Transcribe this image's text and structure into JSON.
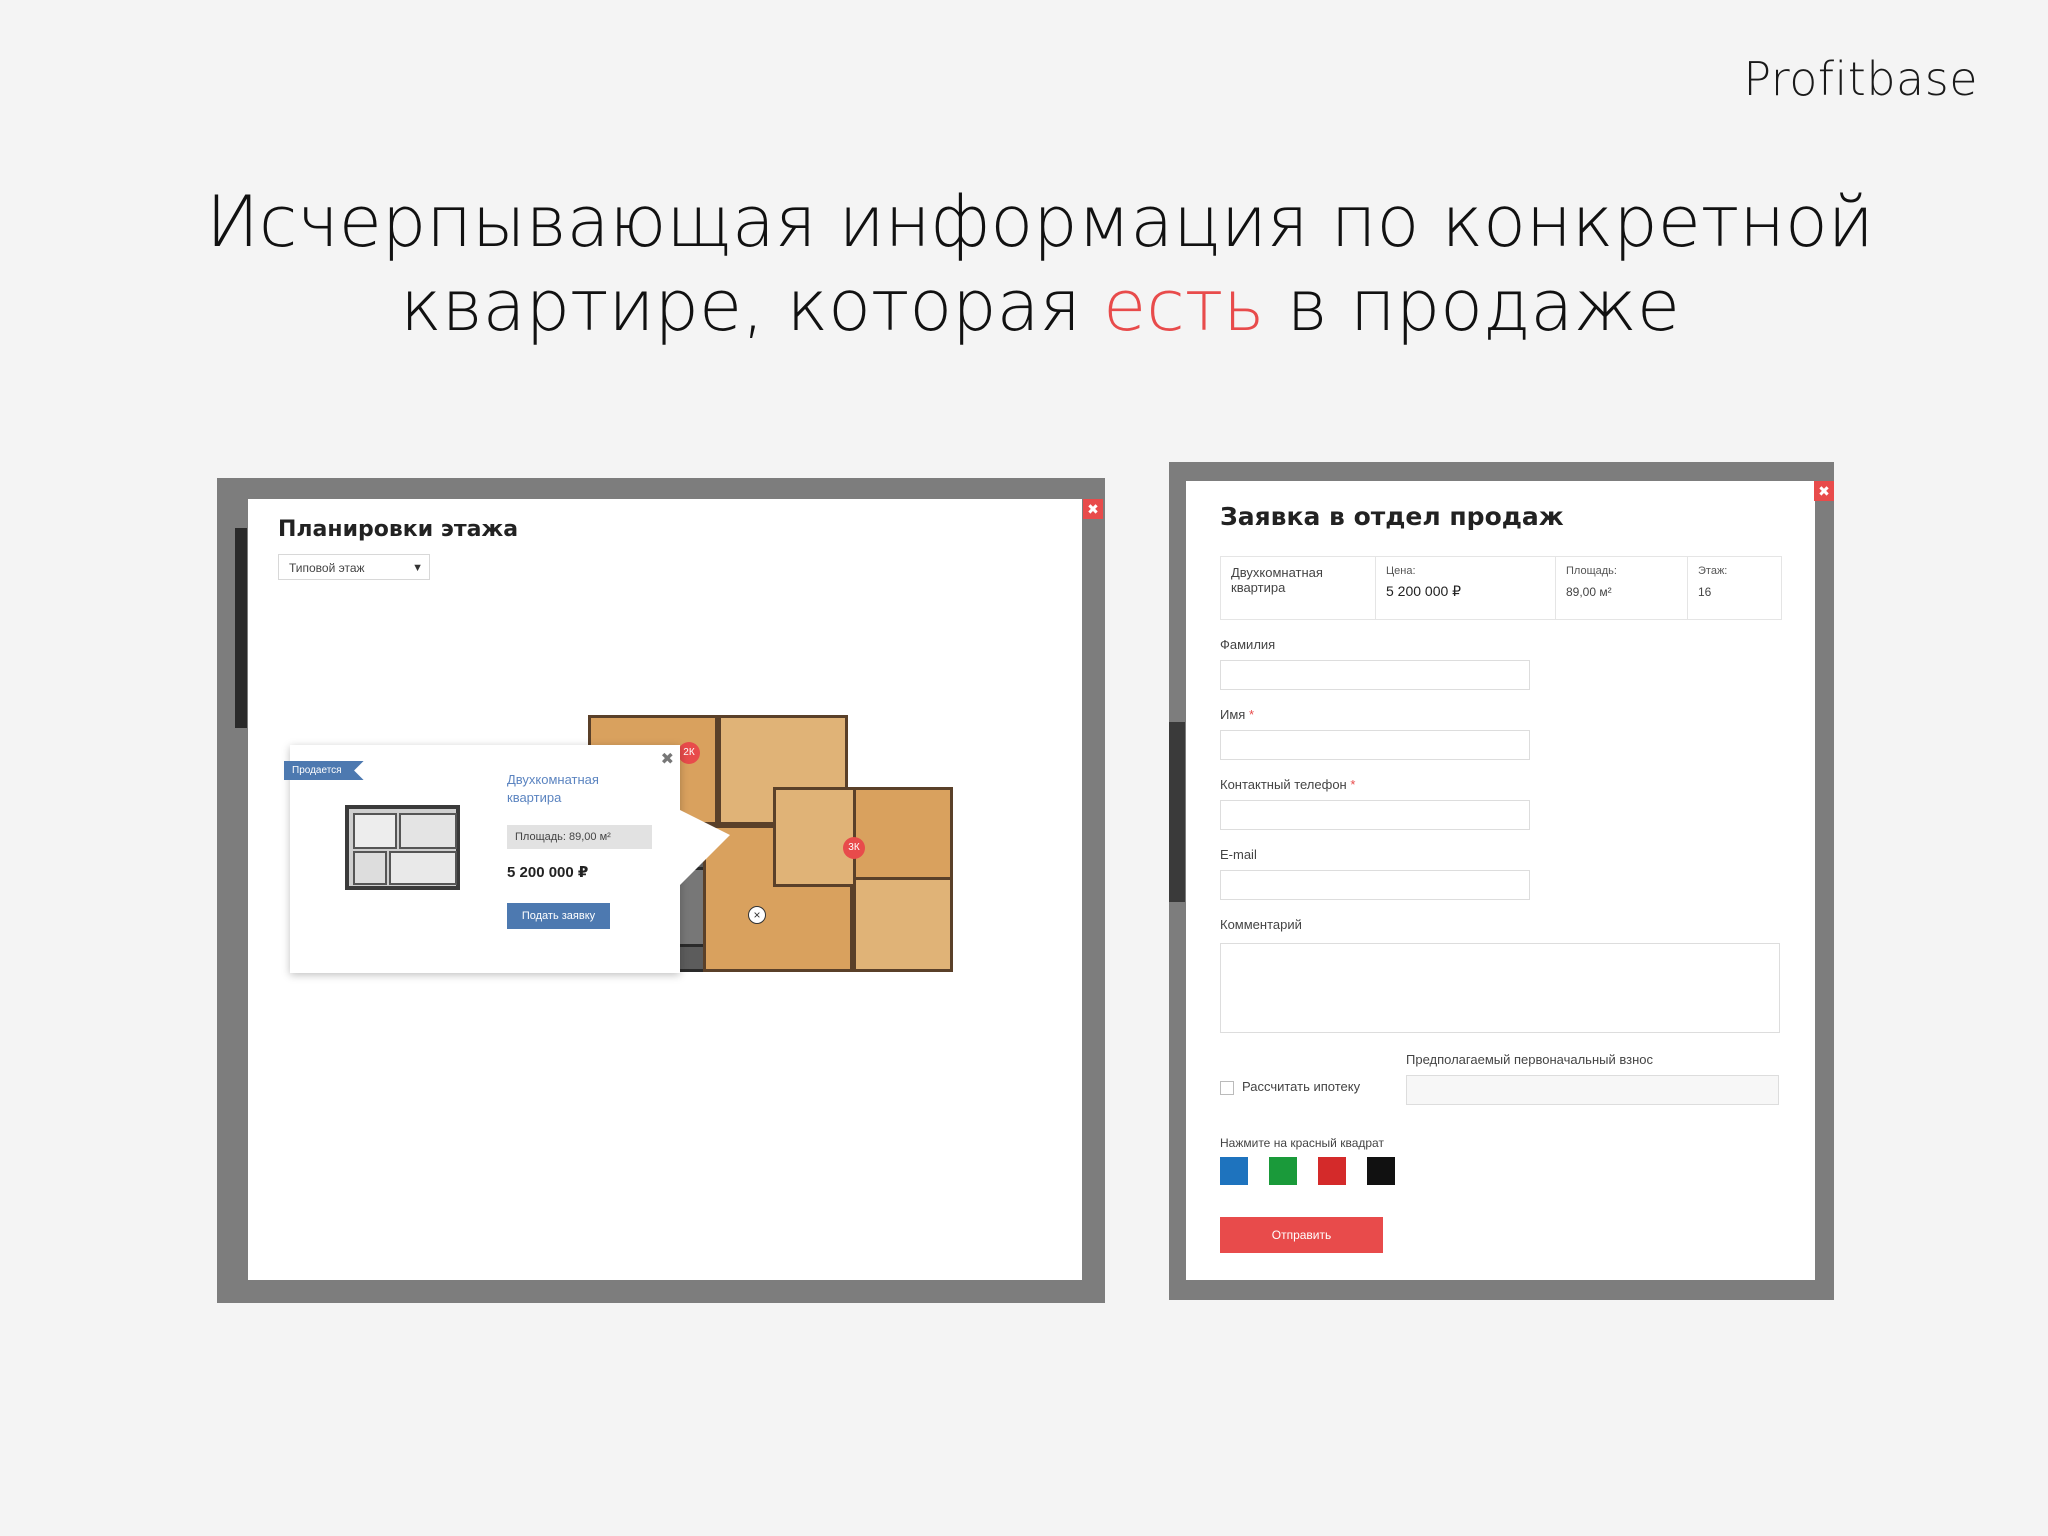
{
  "brand": "Profitbase",
  "headline": {
    "line1": "Исчерпывающая информация по конкретной",
    "line2_start": "квартире, которая ",
    "line2_accent": "есть",
    "line2_end": " в продаже"
  },
  "colors": {
    "accent": "#e84b4b",
    "button_blue": "#4d79b0"
  },
  "floor_modal": {
    "title": "Планировки этажа",
    "floor_select": {
      "value": "Типовой этаж"
    },
    "markers": [
      "2К",
      "3К",
      "2К"
    ],
    "popup": {
      "tag": "Продается",
      "apartment_type": "Двухкомнатная квартира",
      "area": "Площадь: 89,00 м²",
      "price": "5 200 000 ₽",
      "button": "Подать заявку"
    }
  },
  "request_modal": {
    "title": "Заявка в отдел продаж",
    "summary": {
      "type": "Двухкомнатная квартира",
      "price_label": "Цена:",
      "price": "5 200 000 ₽",
      "area_label": "Площадь:",
      "area": "89,00 м²",
      "floor_label": "Этаж:",
      "floor": "16"
    },
    "fields": {
      "surname": "Фамилия",
      "name": "Имя",
      "phone": "Контактный телефон",
      "email": "E-mail",
      "comment": "Комментарий"
    },
    "mortgage": {
      "checkbox_label": "Рассчитать ипотеку",
      "down_payment_label": "Предполагаемый первоначальный взнос"
    },
    "captcha": {
      "instruction": "Нажмите на красный квадрат",
      "swatches": [
        "#1e73be",
        "#1a9a3a",
        "#d42a2a",
        "#111111"
      ]
    },
    "submit": "Отправить"
  }
}
